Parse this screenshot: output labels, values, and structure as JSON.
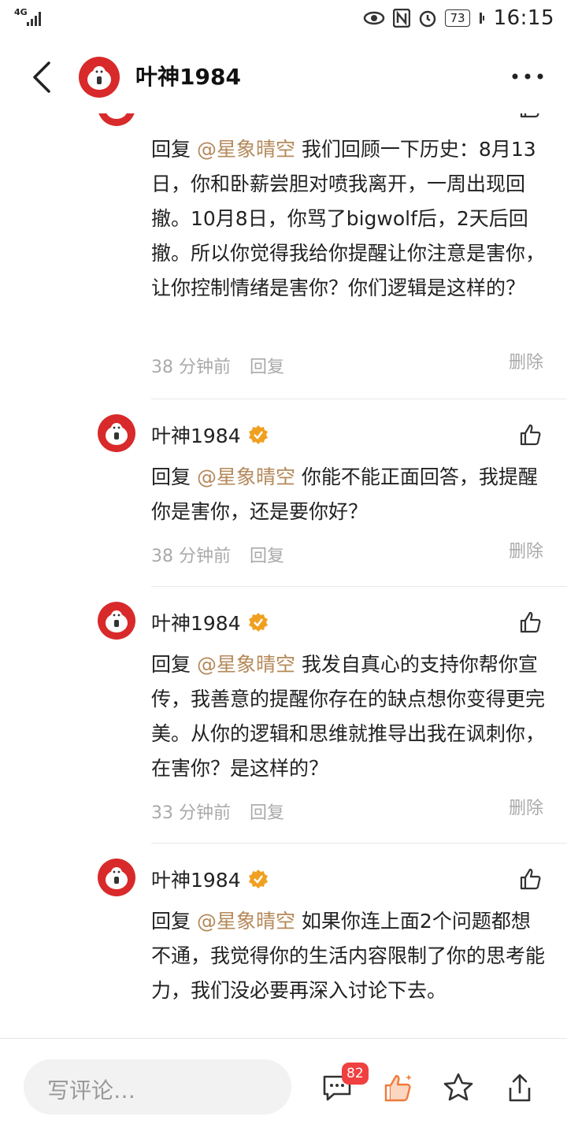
{
  "status_bar": {
    "network": "4G",
    "battery": "73",
    "time": "16:15"
  },
  "header": {
    "title": "叶神1984"
  },
  "comments": [
    {
      "reply_prefix": "回复 ",
      "mention": "@星象晴空",
      "text": " 我们回顾一下历史：8月13日，你和卧薪尝胆对喷我离开，一周出现回撤。10月8日，你骂了bigwolf后，2天后回撤。所以你觉得我给你提醒让你注意是害你，让你控制情绪是害你？你们逻辑是这样的？",
      "time": "38 分钟前",
      "reply_label": "回复",
      "delete_label": "删除"
    },
    {
      "author": "叶神1984",
      "reply_prefix": "回复 ",
      "mention": "@星象晴空",
      "text": " 你能不能正面回答，我提醒你是害你，还是要你好？",
      "time": "38 分钟前",
      "reply_label": "回复",
      "delete_label": "删除"
    },
    {
      "author": "叶神1984",
      "reply_prefix": "回复 ",
      "mention": "@星象晴空",
      "text": " 我发自真心的支持你帮你宣传，我善意的提醒你存在的缺点想你变得更完美。从你的逻辑和思维就推导出我在讽刺你，在害你？是这样的？",
      "time": "33 分钟前",
      "reply_label": "回复",
      "delete_label": "删除"
    },
    {
      "author": "叶神1984",
      "reply_prefix": "回复 ",
      "mention": "@星象晴空",
      "text": " 如果你连上面2个问题都想不通，我觉得你的生活内容限制了你的思考能力，我们没必要再深入讨论下去。"
    }
  ],
  "bottom_bar": {
    "input_placeholder": "写评论…",
    "comment_count": "82"
  },
  "colors": {
    "mention": "#b5895a",
    "badge": "#f04040",
    "like_active": "#f07a3a",
    "verified": "#f0a020",
    "avatar_red": "#d82a2a"
  },
  "icons": [
    "back-icon",
    "more-icon",
    "verified-icon",
    "like-icon",
    "comment-icon",
    "like-filled-icon",
    "star-icon",
    "share-icon"
  ]
}
